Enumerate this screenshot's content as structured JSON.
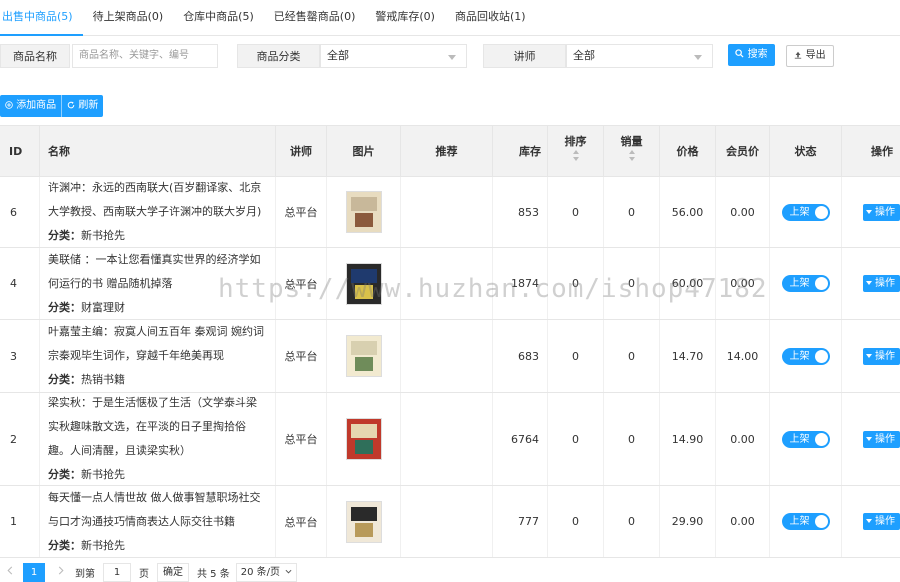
{
  "tabs": [
    {
      "label": "出售中商品(5)",
      "active": true
    },
    {
      "label": "待上架商品(0)",
      "active": false
    },
    {
      "label": "仓库中商品(5)",
      "active": false
    },
    {
      "label": "已经售罄商品(0)",
      "active": false
    },
    {
      "label": "警戒库存(0)",
      "active": false
    },
    {
      "label": "商品回收站(1)",
      "active": false
    }
  ],
  "filters": {
    "name_label": "商品名称",
    "name_placeholder": "商品名称、关键字、编号",
    "category_label": "商品分类",
    "category_value": "全部",
    "teacher_label": "讲师",
    "teacher_value": "全部",
    "search_button": "搜索",
    "export_button": "导出"
  },
  "actions": {
    "add_label": "添加商品",
    "refresh_label": "刷新"
  },
  "columns": {
    "id": "ID",
    "name": "名称",
    "teacher": "讲师",
    "image": "图片",
    "recommend": "推荐",
    "stock": "库存",
    "sort": "排序",
    "sales": "销量",
    "price": "价格",
    "member_price": "会员价",
    "status": "状态",
    "ops": "操作"
  },
  "category_prefix": "分类：",
  "rows": [
    {
      "id": "6",
      "title": "许渊冲：永远的西南联大(百岁翻译家、北京大学教授、西南联大学子许渊冲的联大岁月)",
      "category": "新书抢先",
      "teacher": "总平台",
      "stock": "853",
      "sort": "0",
      "sales": "0",
      "price": "56.00",
      "member_price": "0.00",
      "status": "上架",
      "op": "操作"
    },
    {
      "id": "4",
      "title": "美联储 ：一本让您看懂真实世界的经济学如何运行的书 赠品随机掉落",
      "category": "财富理财",
      "teacher": "总平台",
      "stock": "1874",
      "sort": "0",
      "sales": "0",
      "price": "60.00",
      "member_price": "0.00",
      "status": "上架",
      "op": "操作"
    },
    {
      "id": "3",
      "title": "叶嘉莹主编：寂寞人间五百年 秦观词 婉约词宗秦观毕生词作，穿越千年绝美再现",
      "category": "热销书籍",
      "teacher": "总平台",
      "stock": "683",
      "sort": "0",
      "sales": "0",
      "price": "14.70",
      "member_price": "14.00",
      "status": "上架",
      "op": "操作"
    },
    {
      "id": "2",
      "title": "梁实秋：于是生活惬极了生活（文学泰斗梁实秋趣味散文选，在平淡的日子里掏拾俗趣。人间清醒，且读梁实秋）",
      "category": "新书抢先",
      "teacher": "总平台",
      "stock": "6764",
      "sort": "0",
      "sales": "0",
      "price": "14.90",
      "member_price": "0.00",
      "status": "上架",
      "op": "操作"
    },
    {
      "id": "1",
      "title": "每天懂一点人情世故 做人做事智慧职场社交与口才沟通技巧情商表达人际交往书籍",
      "category": "新书抢先",
      "teacher": "总平台",
      "stock": "777",
      "sort": "0",
      "sales": "0",
      "price": "29.90",
      "member_price": "0.00",
      "status": "上架",
      "op": "操作"
    }
  ],
  "pager": {
    "current": "1",
    "goto_label": "到第",
    "goto_value": "1",
    "page_unit": "页",
    "confirm": "确定",
    "total": "共 5 条",
    "page_size": "20 条/页"
  },
  "watermark": "https://www.huzhan.com/ishop47182",
  "colors": {
    "accent": "#1e9fff",
    "header_bg": "#f2f2f2",
    "border": "#e6e6e6"
  }
}
